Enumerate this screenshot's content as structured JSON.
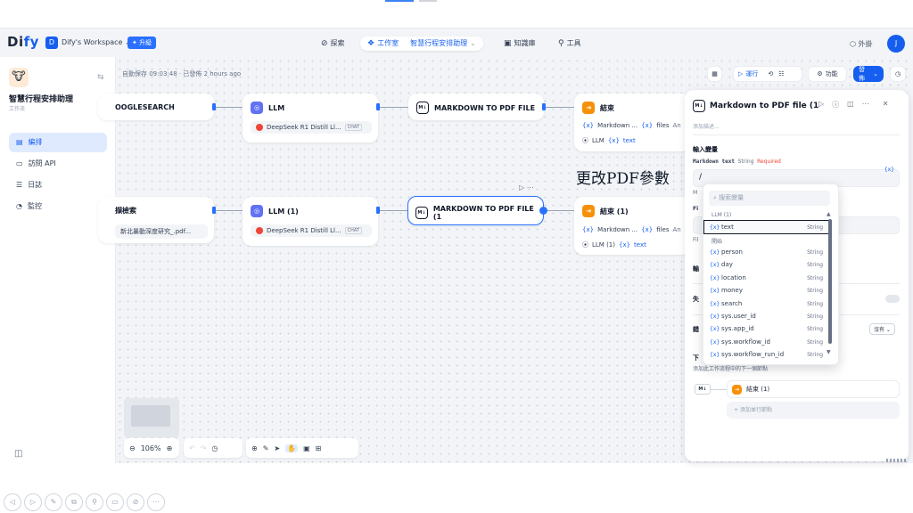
{
  "header": {
    "logo_di": "Di",
    "logo_fy": "fy",
    "workspace_initial": "D",
    "workspace_name": "Dify's Workspace",
    "upgrade": "升級",
    "nav": [
      {
        "label": "探索",
        "icon": "explore-icon"
      },
      {
        "label": "工作室",
        "icon": "studio-icon",
        "sub": "智慧行程安排助理"
      },
      {
        "label": "知識庫",
        "icon": "knowledge-icon"
      },
      {
        "label": "工具",
        "icon": "tools-icon"
      }
    ],
    "plugins": "外掛",
    "user_initial": "J"
  },
  "sidebar": {
    "app_name": "智慧行程安排助理",
    "app_type": "工作流",
    "items": [
      {
        "label": "編排",
        "active": true
      },
      {
        "label": "訪問 API"
      },
      {
        "label": "日誌"
      },
      {
        "label": "監控"
      }
    ]
  },
  "canvas": {
    "autosave": "自動保存 09:03:48 · 已發佈 2 hours ago",
    "annotation": "更改PDF參數",
    "nodes": {
      "google": {
        "title": "OOGLESEARCH"
      },
      "llm1": {
        "title": "LLM",
        "model": "DeepSeek R1 Distill Ll...",
        "tag": "CHAT"
      },
      "md1": {
        "title": "MARKDOWN TO PDF FILE"
      },
      "end1": {
        "title": "結束",
        "row1_var": "Markdown ...",
        "row1_b": "files",
        "row1_extra": "An",
        "row2_src": "LLM",
        "row2_var": "text"
      },
      "doc": {
        "title": "擷檢索",
        "file": "新北暴動深度研究_.pdf..."
      },
      "llm2": {
        "title": "LLM (1)",
        "model": "DeepSeek R1 Distill Ll...",
        "tag": "CHAT"
      },
      "md2": {
        "title": "MARKDOWN TO PDF FILE (1"
      },
      "end2": {
        "title": "結束 (1)",
        "row1_var": "Markdown ...",
        "row1_b": "files",
        "row1_extra": "An",
        "row2_src": "LLM (1)",
        "row2_var": "text"
      }
    }
  },
  "toolbar": {
    "run": "運行",
    "features": "功能",
    "publish": "發佈"
  },
  "zoom": "106%",
  "panel": {
    "title": "Markdown to PDF file (1",
    "desc": "添加描述...",
    "input_section": "輸入變量",
    "field_name": "Markdown text",
    "field_type": "String",
    "field_required": "Required",
    "field_value": "/",
    "m_label": "M",
    "fi_label": "Fi",
    "fil_label": "Fil",
    "output_label": "輸",
    "fail_label": "失",
    "retry_label": "錯",
    "retry_select": "沒有",
    "next_label": "下",
    "next_desc": "添加此工作流程中的下一個節點",
    "next_node": "結束 (1)",
    "add_parallel": "添加並行節點"
  },
  "dropdown": {
    "search_placeholder": "搜索變量",
    "groups": [
      {
        "name": "LLM (1)",
        "items": [
          {
            "name": "text",
            "type": "String",
            "highlight": true
          }
        ]
      },
      {
        "name": "開始",
        "items": [
          {
            "name": "person",
            "type": "String"
          },
          {
            "name": "day",
            "type": "String"
          },
          {
            "name": "location",
            "type": "String"
          },
          {
            "name": "money",
            "type": "String"
          },
          {
            "name": "search",
            "type": "String"
          },
          {
            "name": "sys.user_id",
            "type": "String"
          },
          {
            "name": "sys.app_id",
            "type": "String"
          },
          {
            "name": "sys.workflow_id",
            "type": "String"
          },
          {
            "name": "sys.workflow_run_id",
            "type": "String"
          }
        ]
      }
    ]
  }
}
